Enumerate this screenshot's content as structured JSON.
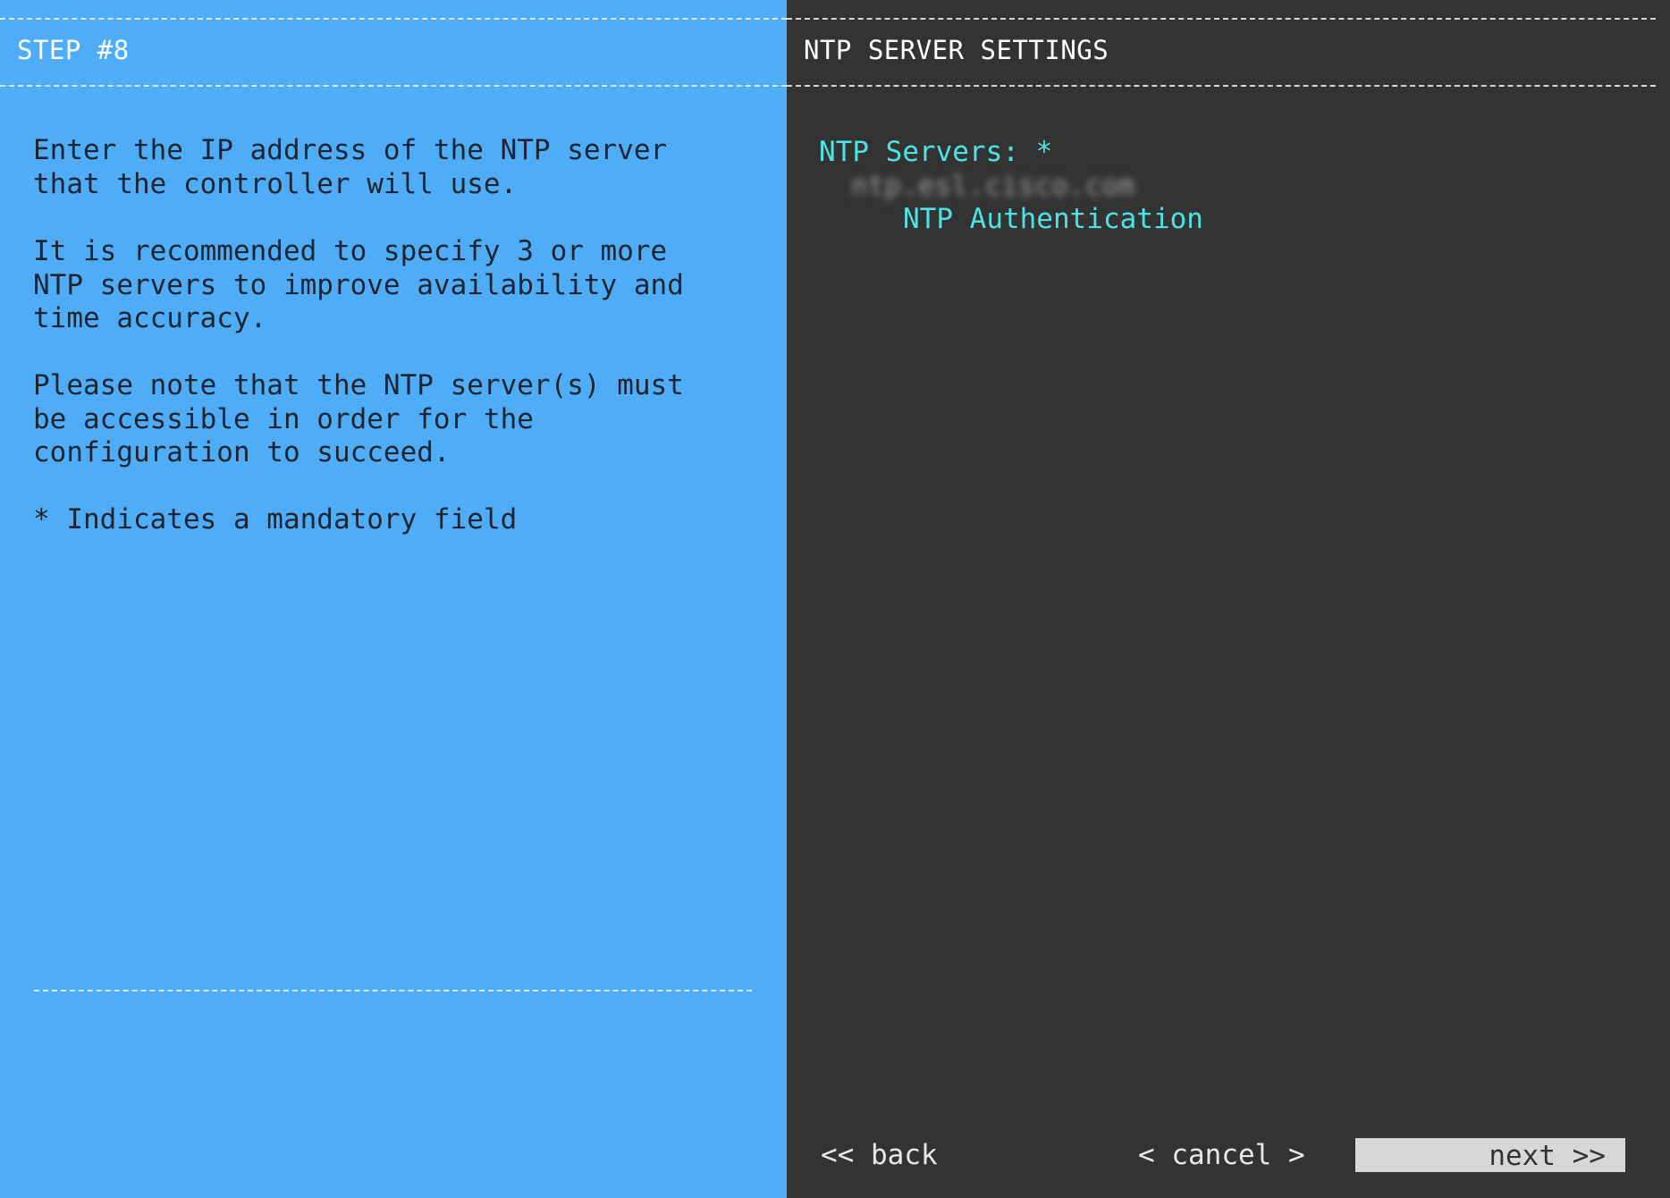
{
  "left_panel": {
    "step_title": "STEP #8",
    "paragraphs": [
      "Enter the IP address of the NTP server\nthat the controller will use.",
      "It is recommended to specify 3 or more\nNTP servers to improve availability and\ntime accuracy.",
      "Please note that the NTP server(s) must\nbe accessible in order for the\nconfiguration to succeed.",
      "* Indicates a mandatory field"
    ]
  },
  "right_panel": {
    "title": "NTP SERVER SETTINGS",
    "ntp_servers_label": "NTP Servers: *",
    "ntp_servers_value": "ntp.esl.cisco.com",
    "ntp_auth_label": "NTP Authentication"
  },
  "buttons": {
    "back": "<< back",
    "cancel": "< cancel >",
    "next": "next >>"
  },
  "colors": {
    "left_bg": "#4fadf8",
    "right_bg": "#333333",
    "field_accent": "#4ee3e3",
    "button_highlight": "#d7d7d7"
  }
}
